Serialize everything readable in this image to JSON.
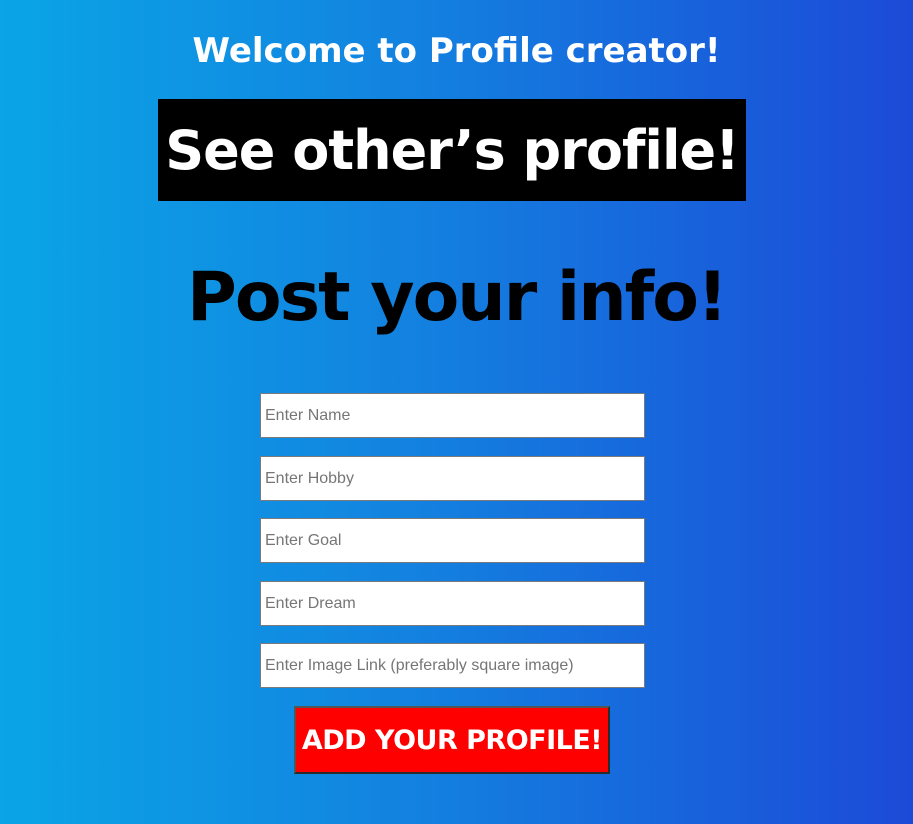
{
  "header": {
    "welcome_text": "Welcome to Profile creator!"
  },
  "nav": {
    "see_profiles_label": "See other’s profile!"
  },
  "form": {
    "title": "Post your info!",
    "fields": [
      {
        "placeholder": "Enter Name",
        "value": ""
      },
      {
        "placeholder": "Enter Hobby",
        "value": ""
      },
      {
        "placeholder": "Enter Goal",
        "value": ""
      },
      {
        "placeholder": "Enter Dream",
        "value": ""
      },
      {
        "placeholder": "Enter Image Link (preferably square image)",
        "value": ""
      }
    ],
    "submit_label": "ADD YOUR PROFILE!"
  },
  "colors": {
    "background_start": "#0aa5e6",
    "background_end": "#1c4ad8",
    "nav_button_bg": "#000000",
    "submit_button_bg": "#ff0000"
  }
}
